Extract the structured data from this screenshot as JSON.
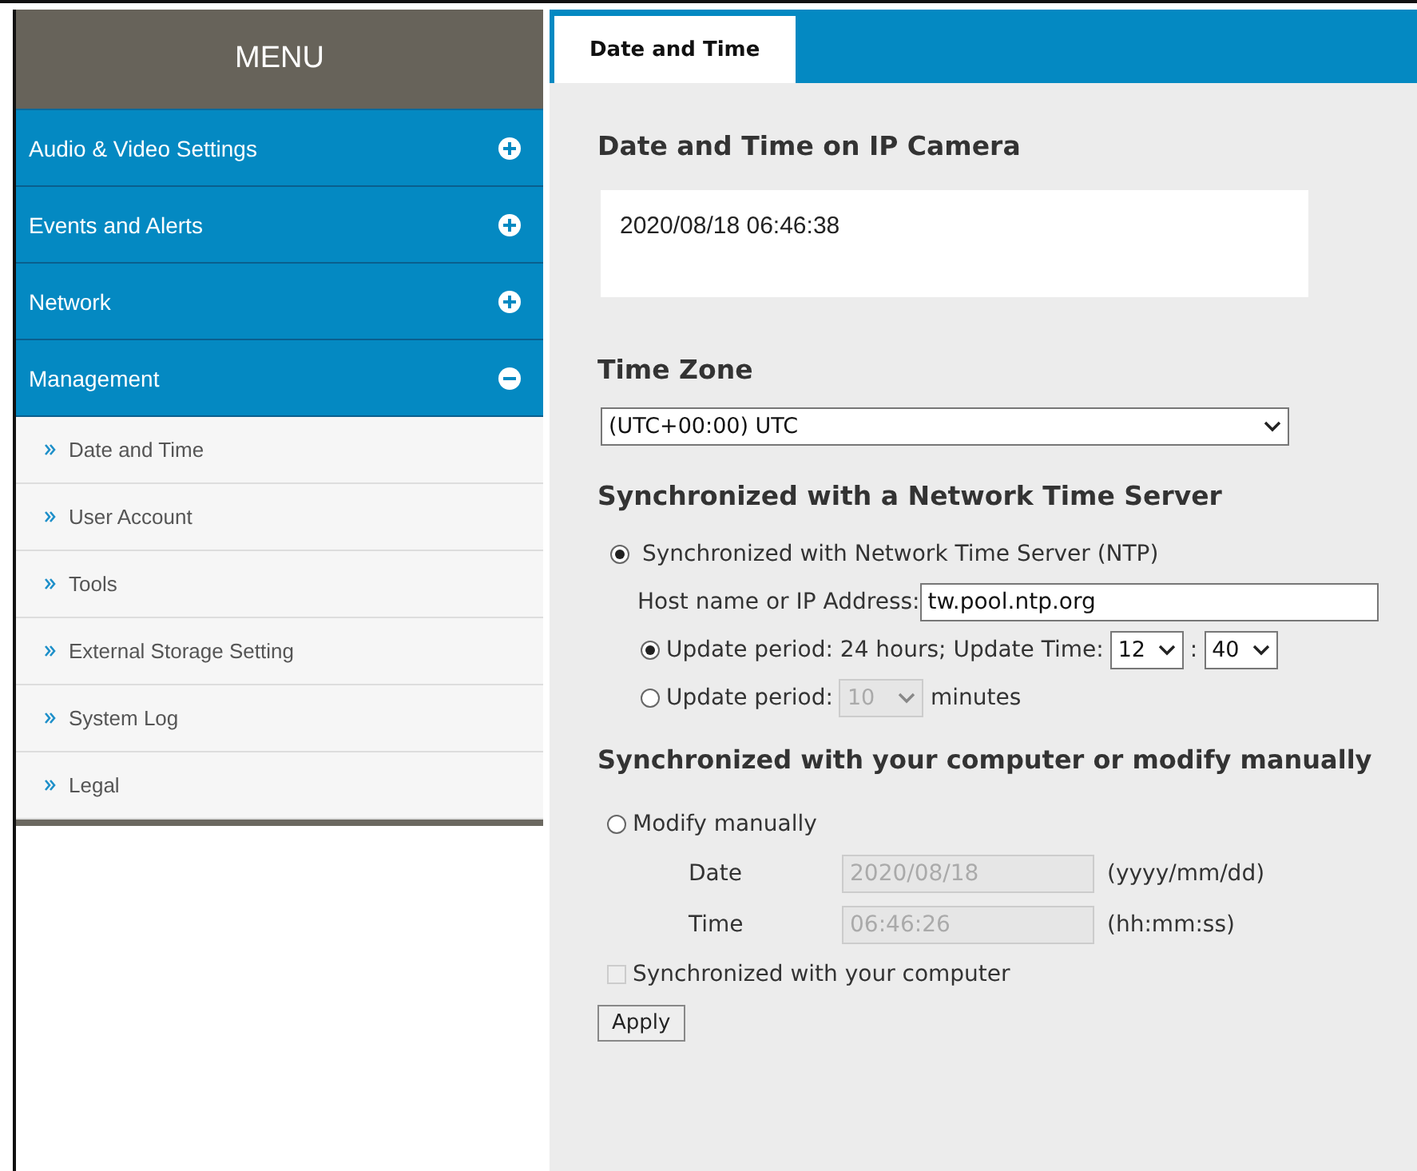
{
  "menu": {
    "title": "MENU",
    "sections": [
      {
        "label": "Audio & Video Settings",
        "expanded": false
      },
      {
        "label": "Events and Alerts",
        "expanded": false
      },
      {
        "label": "Network",
        "expanded": false
      },
      {
        "label": "Management",
        "expanded": true,
        "children": [
          {
            "label": "Date and Time"
          },
          {
            "label": "User Account"
          },
          {
            "label": "Tools"
          },
          {
            "label": "External Storage Setting"
          },
          {
            "label": "System Log"
          },
          {
            "label": "Legal"
          }
        ]
      }
    ]
  },
  "tabs": [
    {
      "label": "Date and Time",
      "selected": true
    }
  ],
  "camera_time": {
    "heading": "Date and Time on IP Camera",
    "value": "2020/08/18 06:46:38"
  },
  "time_zone": {
    "heading": "Time Zone",
    "value": "(UTC+00:00) UTC"
  },
  "ntp": {
    "heading": "Synchronized with a Network Time Server",
    "option": {
      "label": "Synchronized with Network Time Server (NTP)",
      "selected": true
    },
    "host": {
      "label": "Host name or IP Address:",
      "value": "tw.pool.ntp.org"
    },
    "periods": [
      {
        "kind": "daily",
        "selected": true,
        "label": "Update period: 24 hours; Update Time:",
        "hour": "12",
        "separator": ":",
        "minute": "40"
      },
      {
        "kind": "minutes",
        "selected": false,
        "label": "Update period:",
        "value": "10",
        "disabled": true,
        "unit": "minutes"
      }
    ]
  },
  "manual": {
    "heading": "Synchronized with your computer or modify manually",
    "option": {
      "label": "Modify manually",
      "selected": false
    },
    "fields": [
      {
        "label": "Date",
        "value": "2020/08/18",
        "disabled": true,
        "format": "(yyyy/mm/dd)"
      },
      {
        "label": "Time",
        "value": "06:46:26",
        "disabled": true,
        "format": "(hh:mm:ss)"
      }
    ],
    "sync_computer": {
      "label": "Synchronized with your computer",
      "checked": false,
      "disabled": true
    }
  },
  "apply_button": "Apply"
}
